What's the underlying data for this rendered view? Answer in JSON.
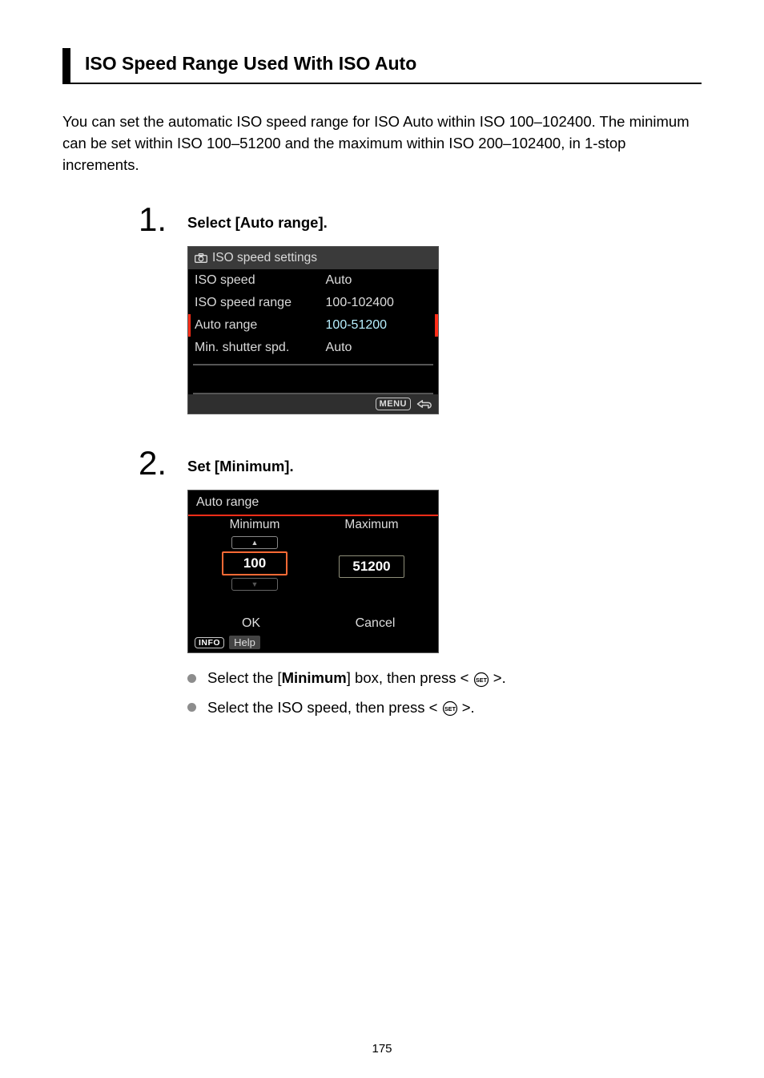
{
  "heading": "ISO Speed Range Used With ISO Auto",
  "intro": "You can set the automatic ISO speed range for ISO Auto within ISO 100–102400. The minimum can be set within ISO 100–51200 and the maximum within ISO 200–102400, in 1-stop increments.",
  "steps": {
    "s1": {
      "number": "1",
      "title": "Select [Auto range].",
      "screen": {
        "title": "ISO speed settings",
        "rows": [
          {
            "label": "ISO speed",
            "value": "Auto"
          },
          {
            "label": "ISO speed range",
            "value": "100-102400"
          },
          {
            "label": "Auto range",
            "value": "100-51200"
          },
          {
            "label": "Min. shutter spd.",
            "value": "Auto"
          }
        ],
        "highlightIndex": 2,
        "footerLabel": "MENU"
      }
    },
    "s2": {
      "number": "2",
      "title": "Set [Minimum].",
      "screen": {
        "title": "Auto range",
        "min": {
          "label": "Minimum",
          "value": "100",
          "selected": true
        },
        "max": {
          "label": "Maximum",
          "value": "51200",
          "selected": false
        },
        "ok": "OK",
        "cancel": "Cancel",
        "infoLabel": "INFO",
        "helpLabel": "Help"
      },
      "bullets": {
        "b1": {
          "pre": "Select the [",
          "bold": "Minimum",
          "post": "] box, then press < ",
          "tail": " >."
        },
        "b2": {
          "pre": "Select the ISO speed, then press < ",
          "tail": " >."
        }
      }
    }
  },
  "pageNumber": "175"
}
